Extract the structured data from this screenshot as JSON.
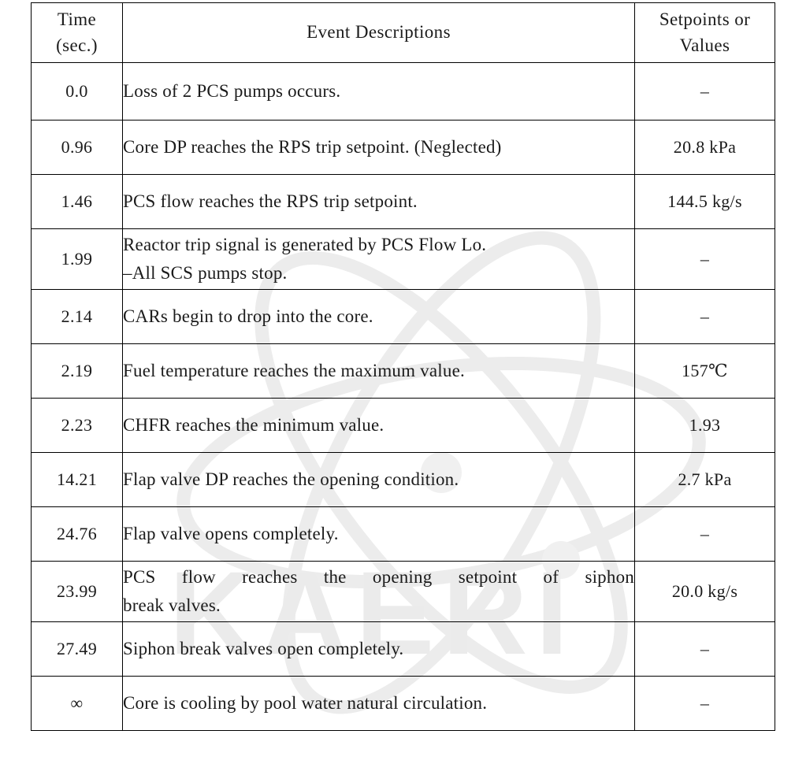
{
  "table": {
    "headers": {
      "time": {
        "line1": "Time",
        "line2": "(sec.)"
      },
      "description": "Event Descriptions",
      "value": {
        "line1": "Setpoints or",
        "line2": "Values"
      }
    },
    "rows": [
      {
        "time": "0.0",
        "description_lines": [
          "Loss of 2 PCS pumps occurs."
        ],
        "value": "–"
      },
      {
        "time": "0.96",
        "description_lines": [
          "Core DP reaches the RPS trip setpoint. (Neglected)"
        ],
        "value": "20.8 kPa"
      },
      {
        "time": "1.46",
        "description_lines": [
          "PCS flow reaches the RPS trip setpoint."
        ],
        "value": "144.5 kg/s"
      },
      {
        "time": "1.99",
        "description_lines": [
          "Reactor trip signal is generated by PCS Flow Lo.",
          "–All SCS pumps stop."
        ],
        "value": "–"
      },
      {
        "time": "2.14",
        "description_lines": [
          "CARs begin to drop into the core."
        ],
        "value": "–"
      },
      {
        "time": "2.19",
        "description_lines": [
          "Fuel temperature reaches the maximum value."
        ],
        "value": "157℃"
      },
      {
        "time": "2.23",
        "description_lines": [
          "CHFR reaches the minimum value."
        ],
        "value": "1.93"
      },
      {
        "time": "14.21",
        "description_lines": [
          "Flap valve DP reaches the opening condition."
        ],
        "value": "2.7 kPa"
      },
      {
        "time": "24.76",
        "description_lines": [
          "Flap valve opens completely."
        ],
        "value": "–"
      },
      {
        "time": "23.99",
        "description_lines": [
          "PCS flow reaches the opening setpoint of siphon",
          "break valves."
        ],
        "value": "20.0 kg/s",
        "justified": true
      },
      {
        "time": "27.49",
        "description_lines": [
          "Siphon break valves open completely."
        ],
        "value": "–"
      },
      {
        "time": "∞",
        "description_lines": [
          "Core is cooling by pool water natural circulation."
        ],
        "value": "–"
      }
    ]
  },
  "watermark": {
    "text": "KAERI",
    "color": "#ebebeb"
  }
}
